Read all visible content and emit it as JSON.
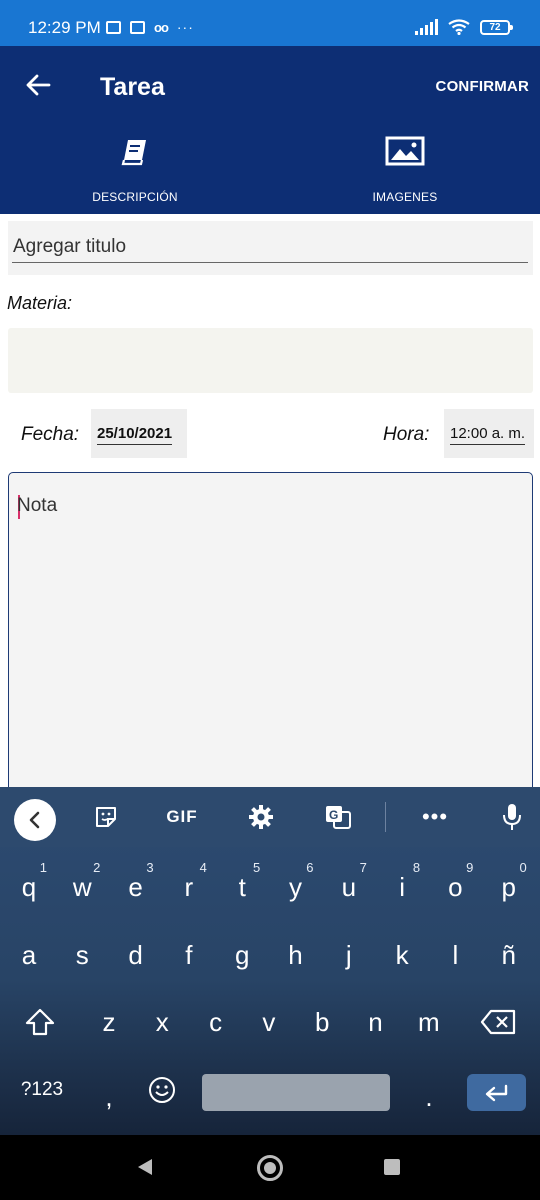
{
  "status_bar": {
    "time": "12:29 PM",
    "more": "···",
    "battery": "72"
  },
  "app_bar": {
    "title": "Tarea",
    "confirm_label": "CONFIRMAR"
  },
  "tabs": [
    {
      "label": "DESCRIPCIÓN",
      "icon": "book-icon"
    },
    {
      "label": "IMAGENES",
      "icon": "image-icon"
    }
  ],
  "form": {
    "title_placeholder": "Agregar titulo",
    "materia_label": "Materia:",
    "fecha_label": "Fecha:",
    "fecha_value": "25/10/2021",
    "hora_label": "Hora:",
    "hora_value": "12:00 a. m.",
    "note_placeholder": "Nota"
  },
  "keyboard": {
    "gif_label": "GIF",
    "more_label": "•••",
    "row1": [
      {
        "key": "q",
        "hint": "1"
      },
      {
        "key": "w",
        "hint": "2"
      },
      {
        "key": "e",
        "hint": "3"
      },
      {
        "key": "r",
        "hint": "4"
      },
      {
        "key": "t",
        "hint": "5"
      },
      {
        "key": "y",
        "hint": "6"
      },
      {
        "key": "u",
        "hint": "7"
      },
      {
        "key": "i",
        "hint": "8"
      },
      {
        "key": "o",
        "hint": "9"
      },
      {
        "key": "p",
        "hint": "0"
      }
    ],
    "row2": [
      "a",
      "s",
      "d",
      "f",
      "g",
      "h",
      "j",
      "k",
      "l",
      "ñ"
    ],
    "row3": [
      "z",
      "x",
      "c",
      "v",
      "b",
      "n",
      "m"
    ],
    "symbols_label": "?123",
    "comma": ",",
    "period": "."
  }
}
